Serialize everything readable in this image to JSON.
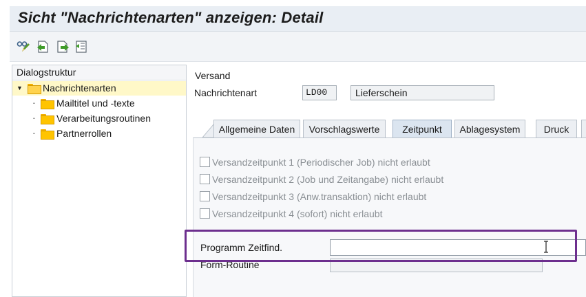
{
  "window": {
    "title": "Sicht \"Nachrichtenarten\" anzeigen: Detail"
  },
  "toolbar": {
    "icons": [
      "glasses-pencil-icon",
      "previous-entry-icon",
      "next-entry-icon",
      "variable-list-icon"
    ]
  },
  "dialog_structure": {
    "header": "Dialogstruktur",
    "items": [
      {
        "label": "Nachrichtenarten",
        "level": 0,
        "expanded": true,
        "selected": true
      },
      {
        "label": "Mailtitel und -texte",
        "level": 1
      },
      {
        "label": "Verarbeitungsroutinen",
        "level": 1
      },
      {
        "label": "Partnerrollen",
        "level": 1
      }
    ]
  },
  "header_section": {
    "group_label": "Versand",
    "message_type_label": "Nachrichtenart",
    "message_type_value": "LD00",
    "message_type_description": "Lieferschein"
  },
  "tabs": [
    {
      "label": "Allgemeine Daten",
      "active": false
    },
    {
      "label": "Vorschlagswerte",
      "active": false
    },
    {
      "label": "Zeitpunkt",
      "active": true
    },
    {
      "label": "Ablagesystem",
      "active": false
    },
    {
      "label": "Druck",
      "active": false
    }
  ],
  "zeitpunkt": {
    "checkboxes": [
      {
        "label": "Versandzeitpunkt 1 (Periodischer Job) nicht erlaubt",
        "checked": false
      },
      {
        "label": "Versandzeitpunkt 2 (Job und Zeitangabe) nicht erlaubt",
        "checked": false
      },
      {
        "label": "Versandzeitpunkt 3 (Anw.transaktion) nicht erlaubt",
        "checked": false
      },
      {
        "label": "Versandzeitpunkt 4 (sofort) nicht erlaubt",
        "checked": false
      }
    ],
    "program_label": "Programm Zeitfind.",
    "program_value": "",
    "form_routine_label": "Form-Routine",
    "form_routine_value": ""
  },
  "colors": {
    "highlight": "#6d2f8e",
    "selected_row": "#fff8c8",
    "folder": "#ffc400"
  }
}
